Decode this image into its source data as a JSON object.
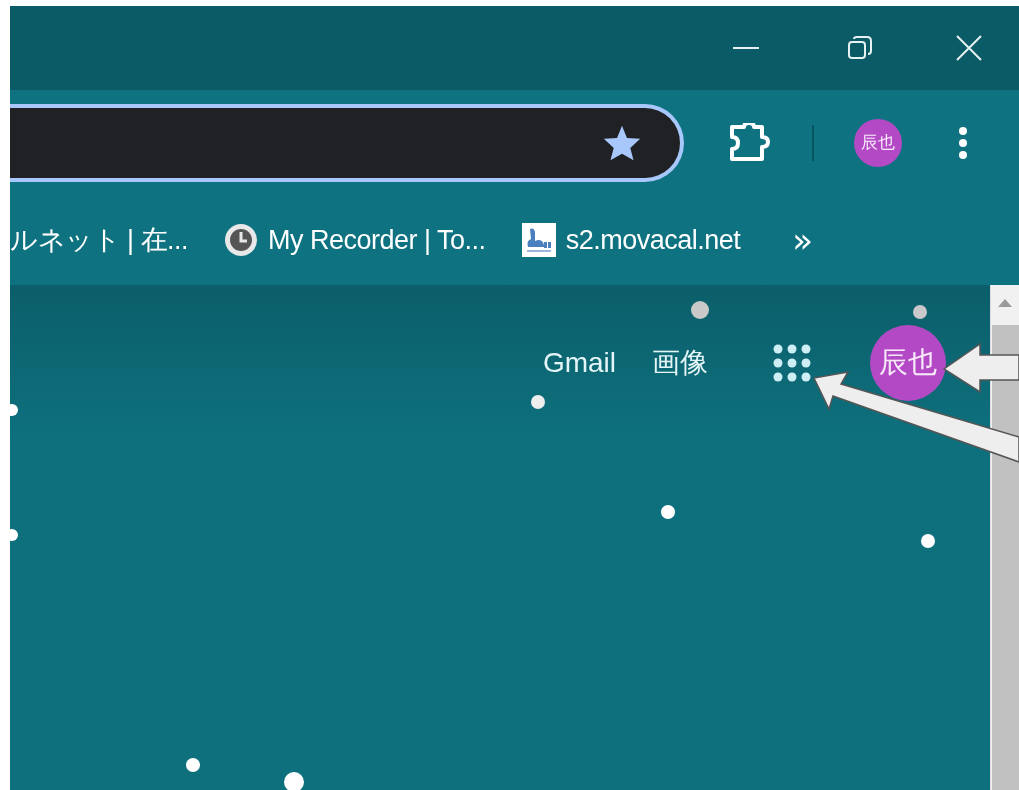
{
  "toolbar": {
    "account_initials": "辰也"
  },
  "bookmarks": [
    {
      "title": "ルネット | 在...",
      "kind": "plain"
    },
    {
      "title": "My Recorder | To...",
      "kind": "clock"
    },
    {
      "title": "s2.movacal.net",
      "kind": "site"
    }
  ],
  "bookmarks_overflow": "»",
  "page": {
    "links": [
      "Gmail",
      "画像"
    ],
    "account_initials": "辰也"
  }
}
